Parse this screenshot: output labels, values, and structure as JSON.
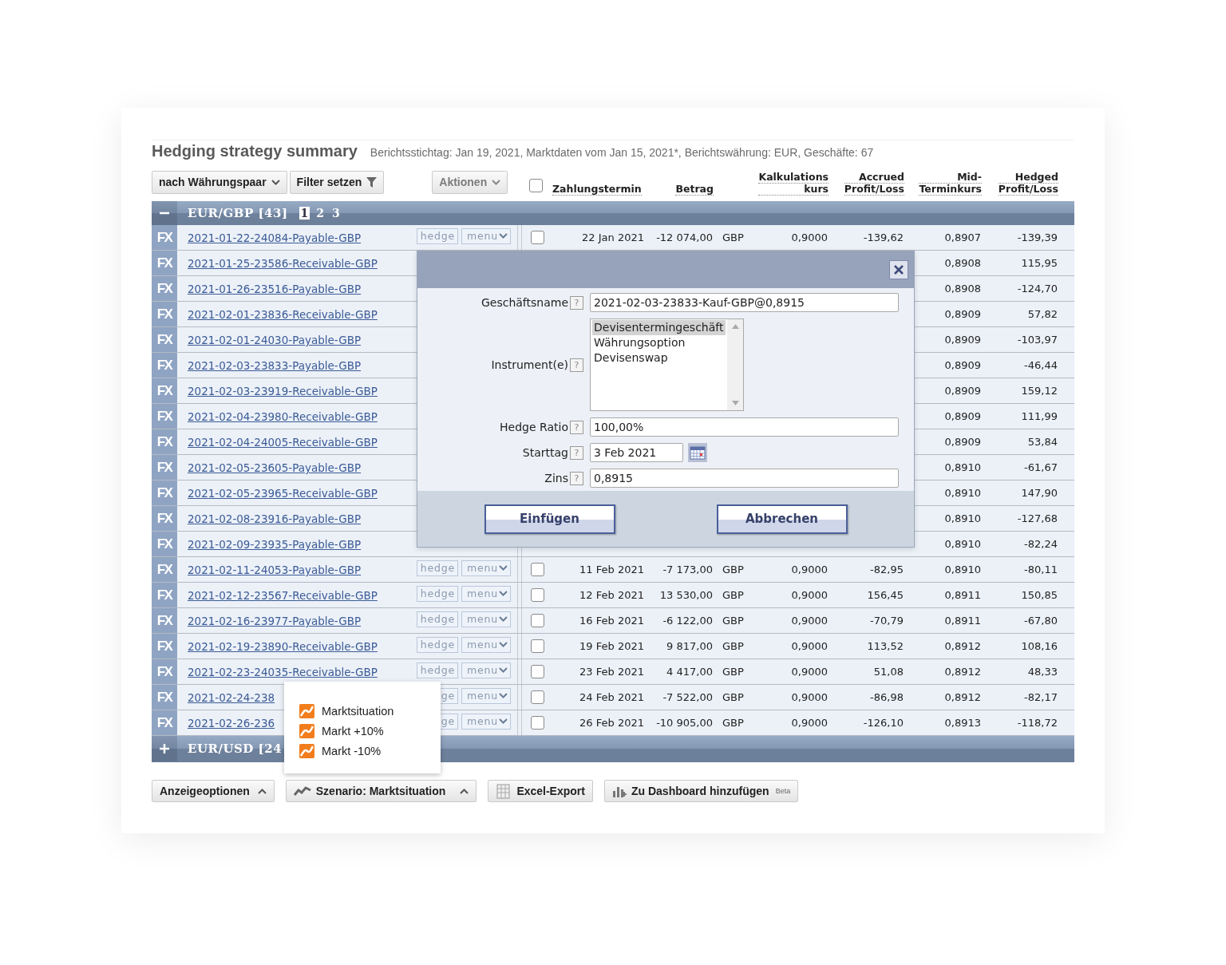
{
  "header": {
    "title": "Hedging strategy summary",
    "subtitle": "Berichtsstichtag: Jan 19, 2021, Marktdaten vom Jan 15, 2021*, Berichtswährung: EUR, Geschäfte: 67"
  },
  "toolbar": {
    "group_by": "nach Währungspaar",
    "filter": "Filter setzen",
    "actions": "Aktionen",
    "actions_disabled": true,
    "select_all": {
      "checked": false
    }
  },
  "columns": [
    {
      "lines": [
        "Zahlungstermin"
      ]
    },
    {
      "lines": [
        "Betrag"
      ]
    },
    {
      "lines": [
        "Kalkulations",
        "kurs"
      ]
    },
    {
      "lines": [
        "Accrued",
        "Profit/Loss"
      ]
    },
    {
      "lines": [
        "Mid-",
        "Terminkurs"
      ]
    },
    {
      "lines": [
        "Hedged",
        "Profit/Loss"
      ]
    }
  ],
  "groups": [
    {
      "label": "EUR/GBP [43]",
      "expanded": true,
      "pages": [
        {
          "label": "1",
          "selected": true
        },
        {
          "label": "2",
          "selected": false
        },
        {
          "label": "3",
          "selected": false
        }
      ],
      "rows": [
        {
          "badge": "FX",
          "name": "2021-01-22-24084-Payable-GBP",
          "hedge": "hedge",
          "menu": "menu",
          "checked": false,
          "date": "22 Jan 2021",
          "amount": "-12 074,00",
          "currency": "GBP",
          "calc_rate": "0,9000",
          "accrued": "-139,62",
          "mid_rate": "0,8907",
          "hedged": "-139,39"
        },
        {
          "badge": "FX",
          "name": "2021-01-25-23586-Receivable-GBP",
          "mid_rate": "0,8908",
          "hedged": "115,95"
        },
        {
          "badge": "FX",
          "name": "2021-01-26-23516-Payable-GBP",
          "mid_rate": "0,8908",
          "hedged": "-124,70"
        },
        {
          "badge": "FX",
          "name": "2021-02-01-23836-Receivable-GBP",
          "mid_rate": "0,8909",
          "hedged": "57,82"
        },
        {
          "badge": "FX",
          "name": "2021-02-01-24030-Payable-GBP",
          "mid_rate": "0,8909",
          "hedged": "-103,97"
        },
        {
          "badge": "FX",
          "name": "2021-02-03-23833-Payable-GBP",
          "mid_rate": "0,8909",
          "hedged": "-46,44"
        },
        {
          "badge": "FX",
          "name": "2021-02-03-23919-Receivable-GBP",
          "mid_rate": "0,8909",
          "hedged": "159,12"
        },
        {
          "badge": "FX",
          "name": "2021-02-04-23980-Receivable-GBP",
          "mid_rate": "0,8909",
          "hedged": "111,99"
        },
        {
          "badge": "FX",
          "name": "2021-02-04-24005-Receivable-GBP",
          "mid_rate": "0,8909",
          "hedged": "53,84"
        },
        {
          "badge": "FX",
          "name": "2021-02-05-23605-Payable-GBP",
          "mid_rate": "0,8910",
          "hedged": "-61,67"
        },
        {
          "badge": "FX",
          "name": "2021-02-05-23965-Receivable-GBP",
          "mid_rate": "0,8910",
          "hedged": "147,90"
        },
        {
          "badge": "FX",
          "name": "2021-02-08-23916-Payable-GBP",
          "mid_rate": "0,8910",
          "hedged": "-127,68"
        },
        {
          "badge": "FX",
          "name": "2021-02-09-23935-Payable-GBP",
          "mid_rate": "0,8910",
          "hedged": "-82,24"
        },
        {
          "badge": "FX",
          "name": "2021-02-11-24053-Payable-GBP",
          "hedge": "hedge",
          "menu": "menu",
          "checked": false,
          "date": "11 Feb 2021",
          "amount": "-7 173,00",
          "currency": "GBP",
          "calc_rate": "0,9000",
          "accrued": "-82,95",
          "mid_rate": "0,8910",
          "hedged": "-80,11"
        },
        {
          "badge": "FX",
          "name": "2021-02-12-23567-Receivable-GBP",
          "hedge": "hedge",
          "menu": "menu",
          "checked": false,
          "date": "12 Feb 2021",
          "amount": "13 530,00",
          "currency": "GBP",
          "calc_rate": "0,9000",
          "accrued": "156,45",
          "mid_rate": "0,8911",
          "hedged": "150,85"
        },
        {
          "badge": "FX",
          "name": "2021-02-16-23977-Payable-GBP",
          "hedge": "hedge",
          "menu": "menu",
          "checked": false,
          "date": "16 Feb 2021",
          "amount": "-6 122,00",
          "currency": "GBP",
          "calc_rate": "0,9000",
          "accrued": "-70,79",
          "mid_rate": "0,8911",
          "hedged": "-67,80"
        },
        {
          "badge": "FX",
          "name": "2021-02-19-23890-Receivable-GBP",
          "hedge": "hedge",
          "menu": "menu",
          "checked": false,
          "date": "19 Feb 2021",
          "amount": "9 817,00",
          "currency": "GBP",
          "calc_rate": "0,9000",
          "accrued": "113,52",
          "mid_rate": "0,8912",
          "hedged": "108,16"
        },
        {
          "badge": "FX",
          "name": "2021-02-23-24035-Receivable-GBP",
          "hedge": "hedge",
          "menu": "menu",
          "checked": false,
          "date": "23 Feb 2021",
          "amount": "4 417,00",
          "currency": "GBP",
          "calc_rate": "0,9000",
          "accrued": "51,08",
          "mid_rate": "0,8912",
          "hedged": "48,33"
        },
        {
          "badge": "FX",
          "name": "2021-02-24-238",
          "hedge": "ge",
          "menu": "menu",
          "checked": false,
          "date": "24 Feb 2021",
          "amount": "-7 522,00",
          "currency": "GBP",
          "calc_rate": "0,9000",
          "accrued": "-86,98",
          "mid_rate": "0,8912",
          "hedged": "-82,17"
        },
        {
          "badge": "FX",
          "name": "2021-02-26-236",
          "hedge": "ge",
          "menu": "menu",
          "checked": false,
          "date": "26 Feb 2021",
          "amount": "-10 905,00",
          "currency": "GBP",
          "calc_rate": "0,9000",
          "accrued": "-126,10",
          "mid_rate": "0,8913",
          "hedged": "-118,72"
        }
      ]
    },
    {
      "label": "EUR/USD [24",
      "expanded": false
    }
  ],
  "dialog": {
    "fields": [
      {
        "kind": "text",
        "label": "Geschäftsname",
        "help": "?",
        "value": "2021-02-03-23833-Kauf-GBP@0,8915"
      },
      {
        "kind": "list",
        "label": "Instrument(e)",
        "help": "?",
        "options": [
          {
            "label": "Devisentermingeschäft",
            "selected": true
          },
          {
            "label": "Währungsoption",
            "selected": false
          },
          {
            "label": "Devisenswap",
            "selected": false
          }
        ]
      },
      {
        "kind": "text",
        "label": "Hedge Ratio",
        "help": "?",
        "value": "100,00%"
      },
      {
        "kind": "date",
        "label": "Starttag",
        "help": "?",
        "value": "3 Feb 2021"
      },
      {
        "kind": "text",
        "label": "Zins",
        "help": "?",
        "value": "0,8915"
      }
    ],
    "buttons": [
      "Einfügen",
      "Abbrechen"
    ]
  },
  "scenario_menu": {
    "items": [
      {
        "label": "Marktsituation"
      },
      {
        "label": "Markt +10%"
      },
      {
        "label": "Markt -10%"
      }
    ]
  },
  "footer": {
    "buttons": [
      {
        "kind": "options",
        "label": "Anzeigeoptionen"
      },
      {
        "kind": "scenario",
        "label": "Szenario: Marktsituation"
      },
      {
        "kind": "export",
        "label": "Excel-Export"
      },
      {
        "kind": "dashboard",
        "label": "Zu Dashboard hinzufügen",
        "badge": "Beta"
      }
    ]
  }
}
